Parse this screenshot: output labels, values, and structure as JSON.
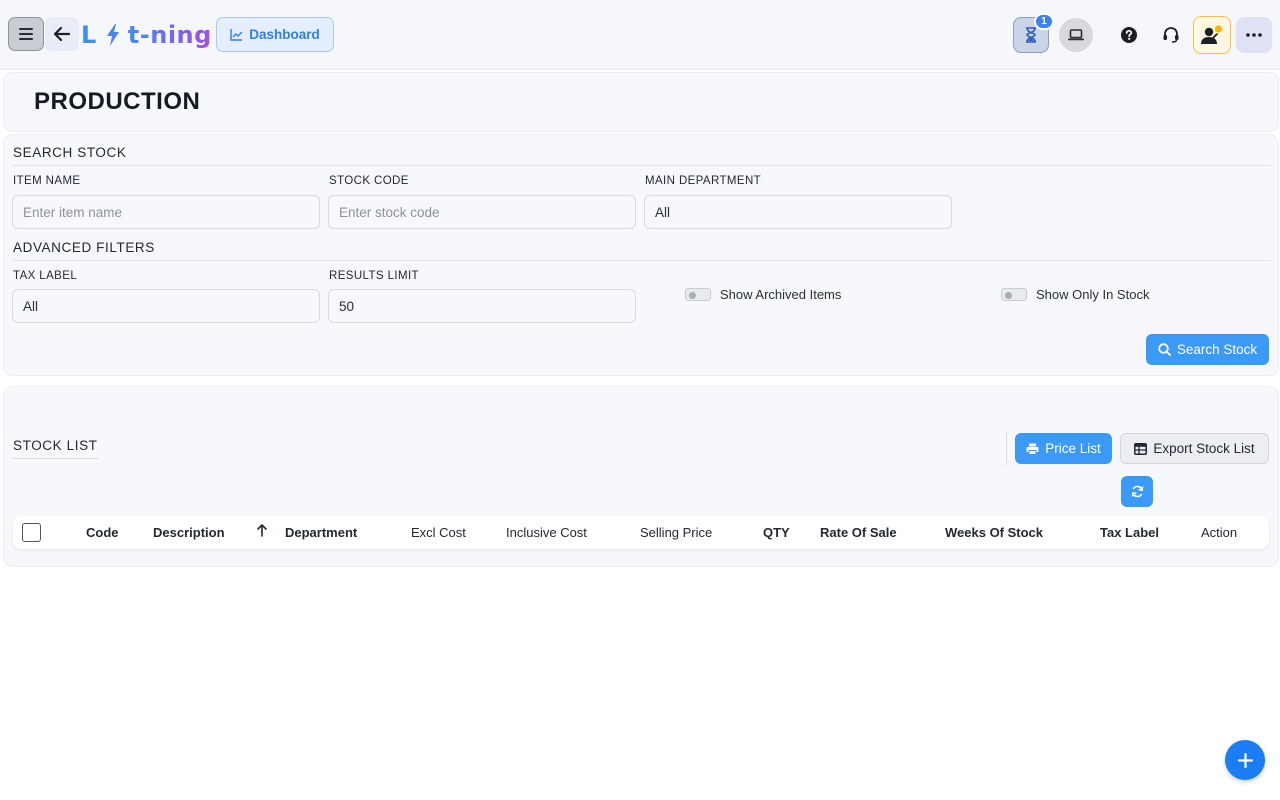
{
  "header": {
    "logo": {
      "first_letter": "L",
      "rest": "t-ning"
    },
    "dashboard_label": "Dashboard",
    "notification_count": "1"
  },
  "page": {
    "title": "PRODUCTION"
  },
  "search": {
    "section_title": "SEARCH STOCK",
    "item_name": {
      "label": "ITEM NAME",
      "placeholder": "Enter item name",
      "value": ""
    },
    "stock_code": {
      "label": "STOCK CODE",
      "placeholder": "Enter stock code",
      "value": ""
    },
    "main_department": {
      "label": "MAIN DEPARTMENT",
      "value": "All"
    },
    "advanced_title": "ADVANCED FILTERS",
    "tax_label": {
      "label": "TAX LABEL",
      "value": "All"
    },
    "results_limit": {
      "label": "RESULTS LIMIT",
      "value": "50"
    },
    "show_archived": {
      "label": "Show Archived Items",
      "checked": false
    },
    "show_in_stock": {
      "label": "Show Only In Stock",
      "checked": false
    },
    "search_button": "Search Stock"
  },
  "stock_list": {
    "title": "STOCK LIST",
    "price_list_button": "Price List",
    "export_button": "Export Stock List",
    "columns": {
      "code": "Code",
      "description": "Description",
      "department": "Department",
      "excl_cost": "Excl Cost",
      "inclusive_cost": "Inclusive Cost",
      "selling_price": "Selling Price",
      "qty": "QTY",
      "rate_of_sale": "Rate Of Sale",
      "weeks_of_stock": "Weeks Of Stock",
      "tax_label": "Tax Label",
      "action": "Action"
    },
    "rows": []
  },
  "colors": {
    "accent": "#3b99f8",
    "fab": "#1a7df5",
    "brand_gradient": [
      "#3f8ef4",
      "#a24fe6"
    ]
  },
  "icons": {
    "menu": "hamburger-icon",
    "back": "arrow-left-icon",
    "dashboard": "chart-line-icon",
    "tasks": "hourglass-icon",
    "device": "laptop-icon",
    "help": "question-icon",
    "support": "headset-icon",
    "user": "user-status-icon",
    "more": "ellipsis-icon",
    "search": "search-icon",
    "print": "printer-icon",
    "export": "table-icon",
    "refresh": "refresh-icon",
    "sort": "arrow-up-icon",
    "add": "plus-icon"
  }
}
